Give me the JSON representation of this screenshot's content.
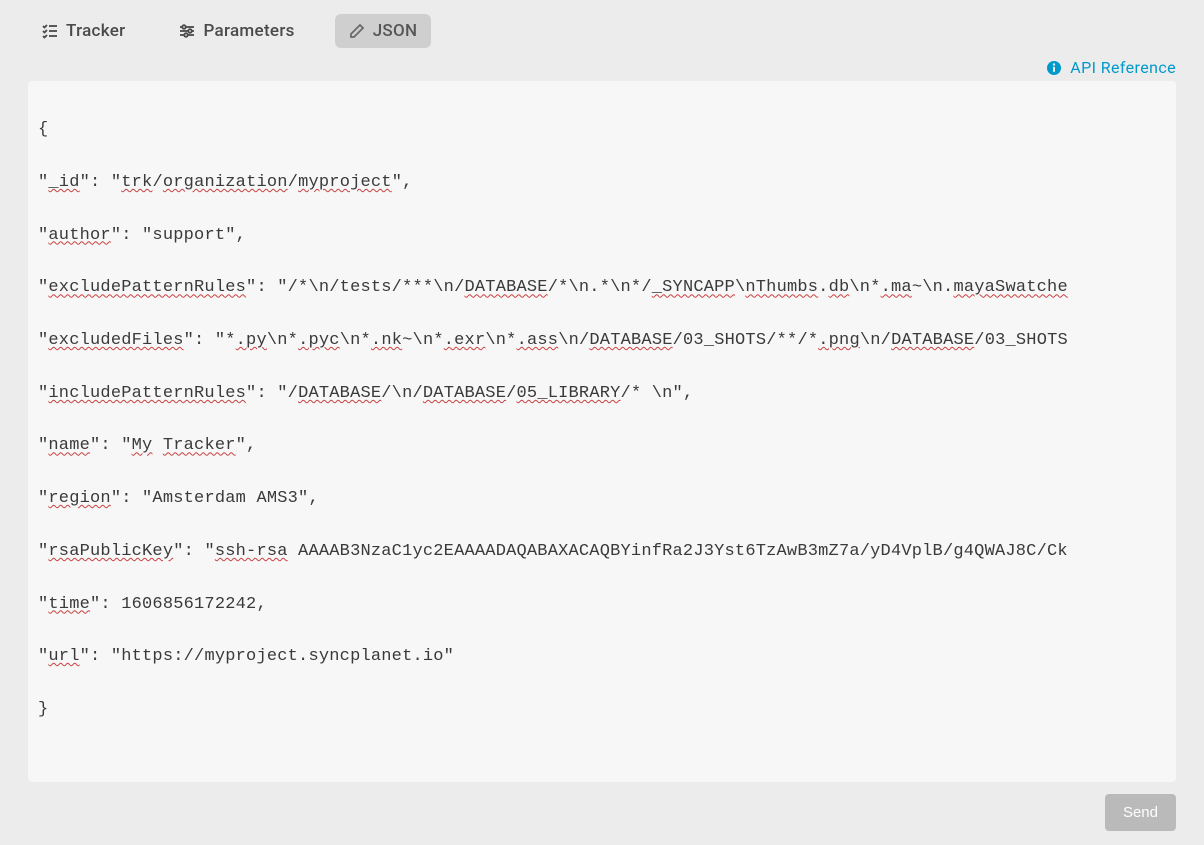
{
  "tabs": {
    "tracker": "Tracker",
    "parameters": "Parameters",
    "json": "JSON"
  },
  "apiRef": "API Reference",
  "sendButton": "Send",
  "json": {
    "open": "{",
    "close": "}",
    "line_id_q1": "\"",
    "line_id_key": "_id",
    "line_id_mid": "\": \"",
    "line_id_v1": "trk",
    "line_id_s1": "/",
    "line_id_v2": "organization",
    "line_id_s2": "/",
    "line_id_v3": "myproject",
    "line_id_end": "\",",
    "line_author_q1": "\"",
    "line_author_key": "author",
    "line_author_rest": "\": \"support\",",
    "line_excl_q1": "\"",
    "line_excl_key": "excludePatternRules",
    "line_excl_mid": "\": \"/*\\n/tests/***\\n/",
    "line_excl_db1": "DATABASE",
    "line_excl_p1": "/*\\n.*\\n*/",
    "line_excl_sync": "_SYNCAPP",
    "line_excl_p2": "\\",
    "line_excl_nthumbs": "nThumbs",
    "line_excl_p3": ".",
    "line_excl_db_ext": "db",
    "line_excl_p4": "\\n*",
    "line_excl_ma": ".ma",
    "line_excl_p5": "~\\n.",
    "line_excl_maya": "mayaSwatche",
    "line_exf_q1": "\"",
    "line_exf_key": "excludedFiles",
    "line_exf_mid": "\": \"*",
    "line_exf_py": ".py",
    "line_exf_p1": "\\n*",
    "line_exf_pyc": ".pyc",
    "line_exf_p2": "\\n*",
    "line_exf_nk": ".nk",
    "line_exf_p3": "~\\n*",
    "line_exf_exr": ".exr",
    "line_exf_p4": "\\n*",
    "line_exf_ass": ".ass",
    "line_exf_p5": "\\n/",
    "line_exf_db1": "DATABASE",
    "line_exf_p6": "/03_SHOTS/**/*",
    "line_exf_png": ".png",
    "line_exf_p7": "\\n/",
    "line_exf_db2": "DATABASE",
    "line_exf_p8": "/03_SHOTS",
    "line_inc_q1": "\"",
    "line_inc_key": "includePatternRules",
    "line_inc_mid": "\": \"/",
    "line_inc_db1": "DATABASE",
    "line_inc_p1": "/\\n/",
    "line_inc_db2": "DATABASE",
    "line_inc_p2": "/",
    "line_inc_lib": "05_LIBRARY",
    "line_inc_rest": "/* \\n\",",
    "line_name_q1": "\"",
    "line_name_key": "name",
    "line_name_mid": "\": \"",
    "line_name_my": "My",
    "line_name_sp": " ",
    "line_name_trk": "Tracker",
    "line_name_end": "\",",
    "line_region_q1": "\"",
    "line_region_key": "region",
    "line_region_rest": "\": \"Amsterdam AMS3\",",
    "line_rsa_q1": "\"",
    "line_rsa_key": "rsaPublicKey",
    "line_rsa_mid": "\": \"",
    "line_rsa_ssh": "ssh-rsa",
    "line_rsa_rest": " AAAAB3NzaC1yc2EAAAADAQABAXACAQBYinfRa2J3Yst6TzAwB3mZ7a/yD4VplB/g4QWAJ8C/Ck",
    "line_time_q1": "\"",
    "line_time_key": "time",
    "line_time_rest": "\": 1606856172242,",
    "line_url_q1": "\"",
    "line_url_key": "url",
    "line_url_rest": "\": \"https://myproject.syncplanet.io\""
  }
}
